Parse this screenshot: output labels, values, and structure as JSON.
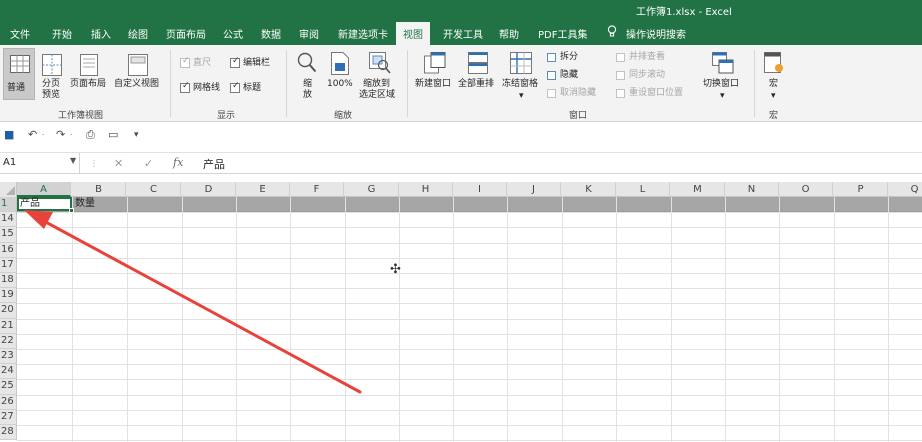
{
  "window": {
    "title": "工作簿1.xlsx - Excel"
  },
  "tabs": [
    "文件",
    "开始",
    "插入",
    "绘图",
    "页面布局",
    "公式",
    "数据",
    "审阅",
    "新建选项卡",
    "视图",
    "开发工具",
    "帮助",
    "PDF工具集"
  ],
  "active_tab": "视图",
  "tell_me": {
    "icon": "lightbulb-icon",
    "label": "操作说明搜索"
  },
  "ribbon": {
    "workbook_views": {
      "label": "工作簿视图",
      "normal": "普通",
      "page_break_1": "分页",
      "page_break_2": "预览",
      "page_layout": "页面布局",
      "custom_views": "自定义视图"
    },
    "show": {
      "label": "显示",
      "ruler": "直尺",
      "formula_bar": "编辑栏",
      "gridlines": "网格线",
      "headings": "标题"
    },
    "zoom": {
      "label": "缩放",
      "zoom_1": "缩",
      "zoom_2": "放",
      "hundred": "100%",
      "to_selection_1": "缩放到",
      "to_selection_2": "选定区域"
    },
    "window": {
      "label": "窗口",
      "new_window": "新建窗口",
      "arrange_all": "全部重排",
      "freeze_panes": "冻结窗格",
      "split": "拆分",
      "hide": "隐藏",
      "unhide": "取消隐藏",
      "side_by_side": "并排查看",
      "sync_scroll": "同步滚动",
      "reset_position": "重设窗口位置",
      "switch_windows": "切换窗口"
    },
    "macros": {
      "label": "宏",
      "macros": "宏"
    }
  },
  "formula_bar": {
    "name_box": "A1",
    "content": "产品"
  },
  "columns": [
    "A",
    "B",
    "C",
    "D",
    "E",
    "F",
    "G",
    "H",
    "I",
    "J",
    "K",
    "L",
    "M",
    "N",
    "O",
    "P",
    "Q"
  ],
  "rows": [
    "1",
    "14",
    "15",
    "16",
    "17",
    "18",
    "19",
    "20",
    "21",
    "22",
    "23",
    "24",
    "25",
    "26",
    "27",
    "28"
  ],
  "cells": {
    "A1": "产品",
    "B1": "数量"
  },
  "colors": {
    "excel_green": "#217346",
    "annotation_arrow": "#e8423b"
  }
}
